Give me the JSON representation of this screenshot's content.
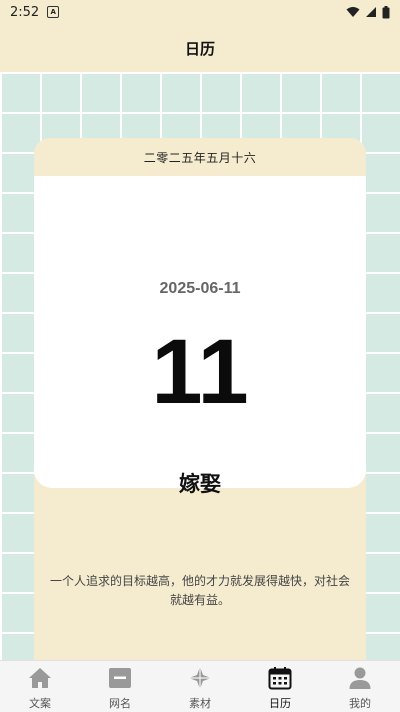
{
  "status": {
    "time": "2:52",
    "notif": "A"
  },
  "header": {
    "title": "日历"
  },
  "card": {
    "lunar_date": "二零二五年五月十六",
    "date": "2025-06-11",
    "day": "11",
    "yi": "嫁娶",
    "quote": "一个人追求的目标越高，他的才力就发展得越快，对社会就越有益。"
  },
  "tabs": [
    {
      "label": "文案",
      "icon": "home-icon",
      "active": false
    },
    {
      "label": "网名",
      "icon": "id-card-icon",
      "active": false
    },
    {
      "label": "素材",
      "icon": "compass-icon",
      "active": false
    },
    {
      "label": "日历",
      "icon": "calendar-icon",
      "active": true
    },
    {
      "label": "我的",
      "icon": "person-icon",
      "active": false
    }
  ],
  "colors": {
    "accent": "#f5ecd0",
    "grid": "#d6eae4",
    "active": "#111111",
    "inactive": "#999999"
  }
}
